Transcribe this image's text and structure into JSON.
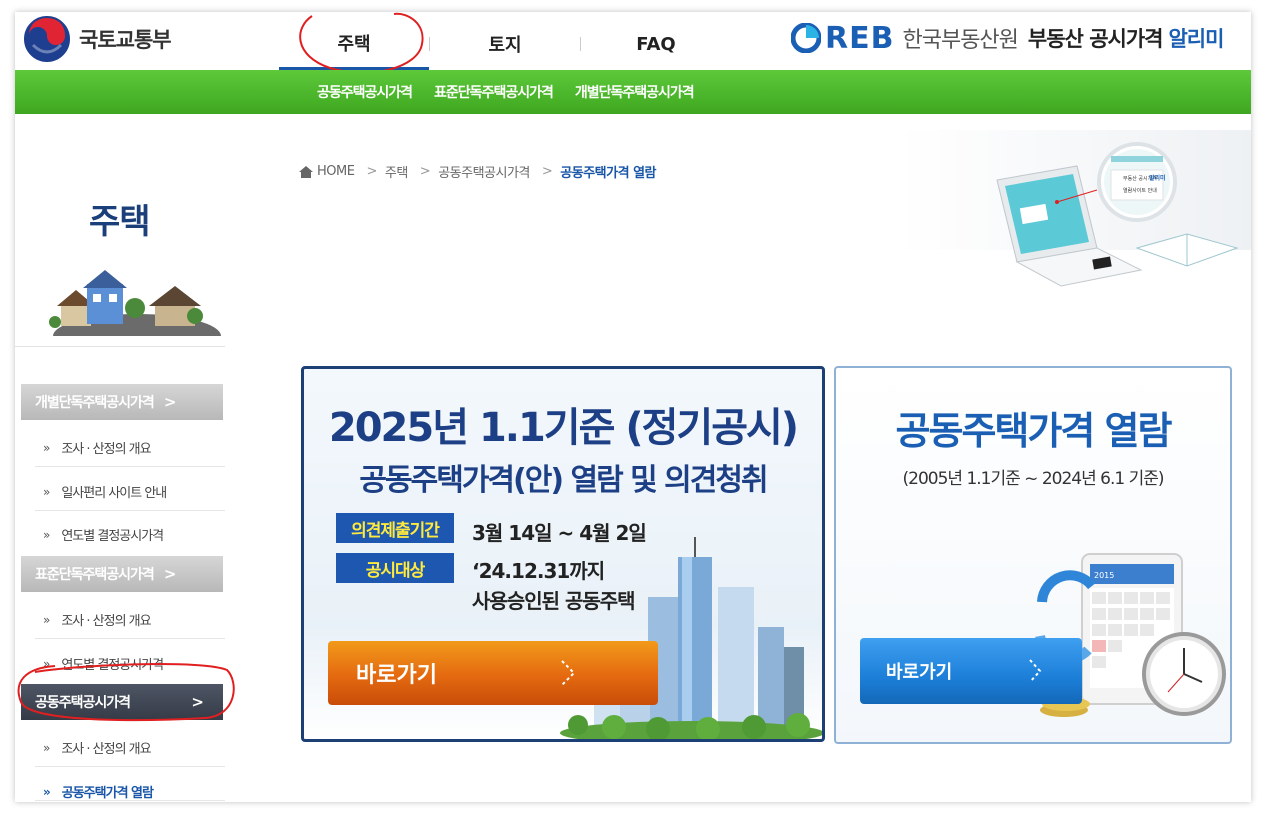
{
  "header": {
    "ministry": "국토교통부",
    "nav_tabs": [
      {
        "label": "주택",
        "active": true
      },
      {
        "label": "토지",
        "active": false
      },
      {
        "label": "FAQ",
        "active": false
      }
    ],
    "brand_letters": "REB",
    "brand_org": "한국부동산원",
    "service_title": "부동산 공시가격",
    "service_app": "알리미"
  },
  "subnav": {
    "items": [
      "공동주택공시가격",
      "표준단독주택공시가격",
      "개별단독주택공시가격"
    ]
  },
  "sidebar": {
    "title": "주택",
    "groups": [
      {
        "label": "개별단독주택공시가격",
        "chevron": ">",
        "items": [
          "조사 · 산정의 개요",
          "일사편리 사이트 안내",
          "연도별 결정공시가격"
        ]
      },
      {
        "label": "표준단독주택공시가격",
        "chevron": ">",
        "items": [
          "조사 · 산정의 개요",
          "연도별 결정공시가격"
        ]
      },
      {
        "label": "공동주택공시가격",
        "chevron": ">",
        "items": [
          "조사 · 산정의 개요",
          "공동주택가격 열람"
        ]
      }
    ],
    "bullet": "»"
  },
  "breadcrumb": {
    "home": "HOME",
    "sep": ">",
    "items": [
      "주택",
      "공동주택공시가격"
    ],
    "current": "공동주택가격 열람"
  },
  "laptop_screen": {
    "line1": "부동산 공시가격",
    "app": "알리미",
    "line2": "열람사이트 안내"
  },
  "card_notice": {
    "title": "2025년 1.1기준 (정기공시)",
    "subtitle": "공동주택가격(안) 열람 및 의견청취",
    "label_period": "의견제출기간",
    "value_period": "3월 14일 ~ 4월 2일",
    "label_target": "공시대상",
    "value_target_line1": "‘24.12.31까지",
    "value_target_line2": "사용승인된 공동주택",
    "button": "바로가기"
  },
  "card_view": {
    "title": "공동주택가격 열람",
    "subtitle": "(2005년 1.1기준 ~ 2024년 6.1 기준)",
    "button": "바로가기",
    "calendar_year": "2015"
  },
  "colors": {
    "green_bar": "#4cb82b",
    "navy": "#1d3f85",
    "blue": "#1a5fb4",
    "orange": "#e46910",
    "annotation_red": "#e02020"
  }
}
